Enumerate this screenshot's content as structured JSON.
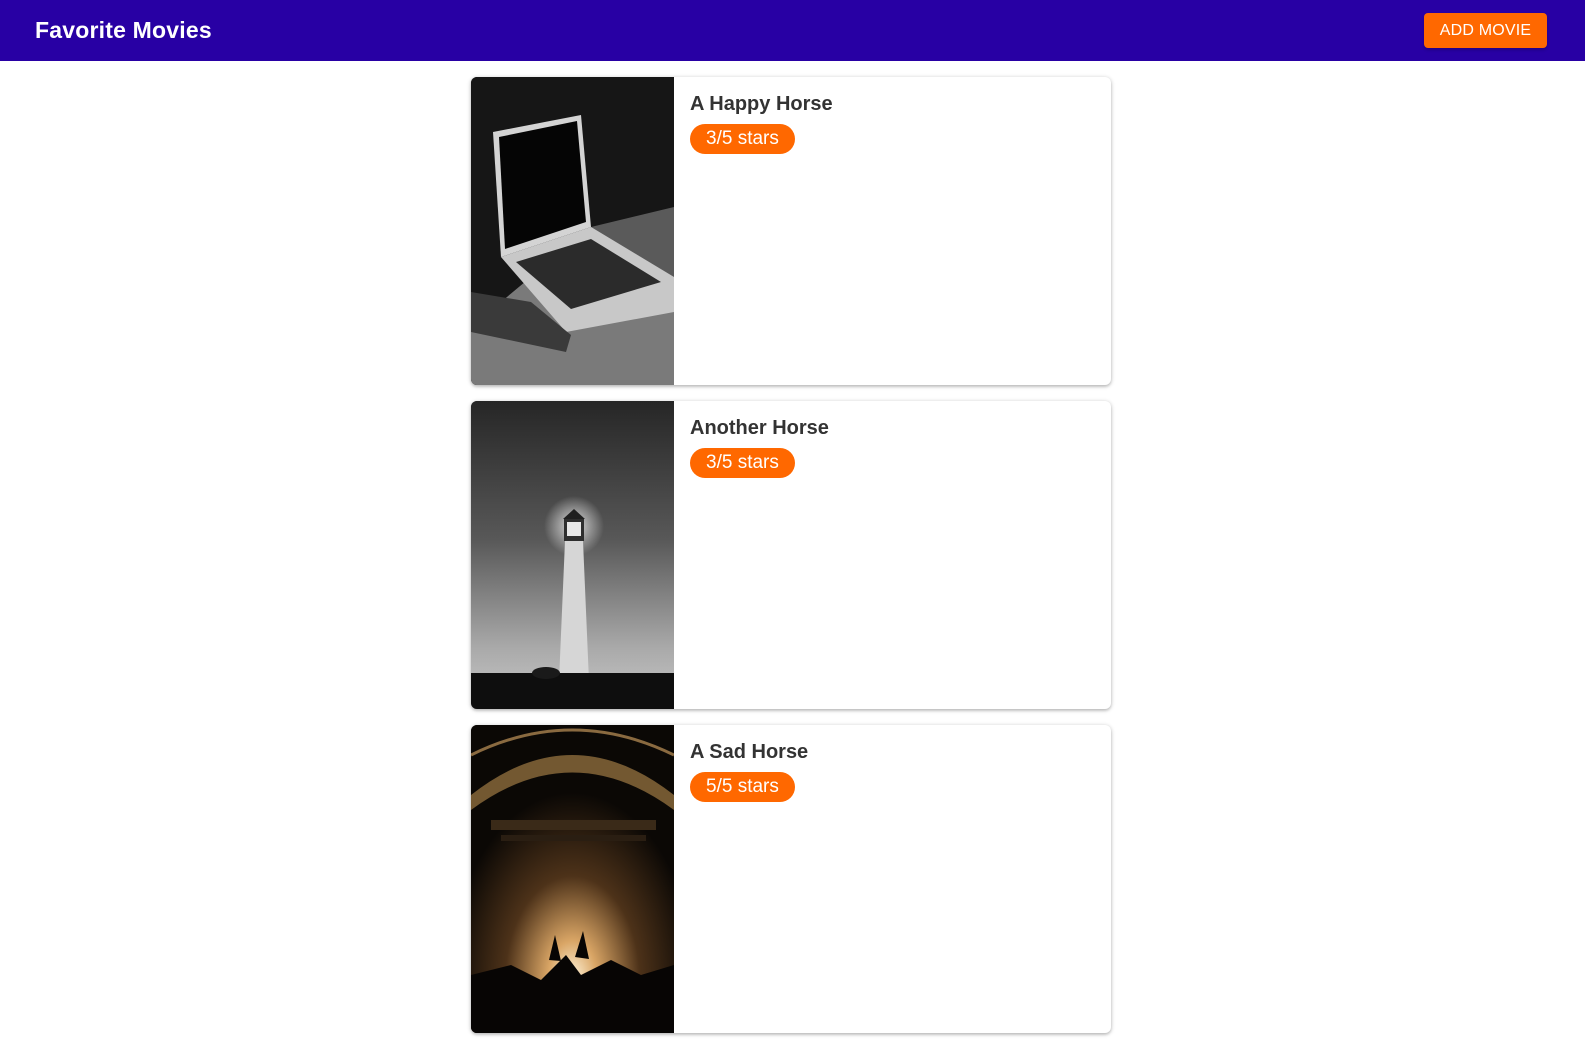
{
  "header": {
    "title": "Favorite Movies",
    "add_button_label": "ADD MOVIE",
    "background_color": "#2800a4",
    "accent_color": "#ff6800"
  },
  "movies": [
    {
      "title": "A Happy Horse",
      "rating_label": "3/5 stars",
      "rating": 3,
      "poster_icon": "laptop-photo"
    },
    {
      "title": "Another Horse",
      "rating_label": "3/5 stars",
      "rating": 3,
      "poster_icon": "lighthouse-photo"
    },
    {
      "title": "A Sad Horse",
      "rating_label": "5/5 stars",
      "rating": 5,
      "poster_icon": "concert-photo"
    }
  ]
}
